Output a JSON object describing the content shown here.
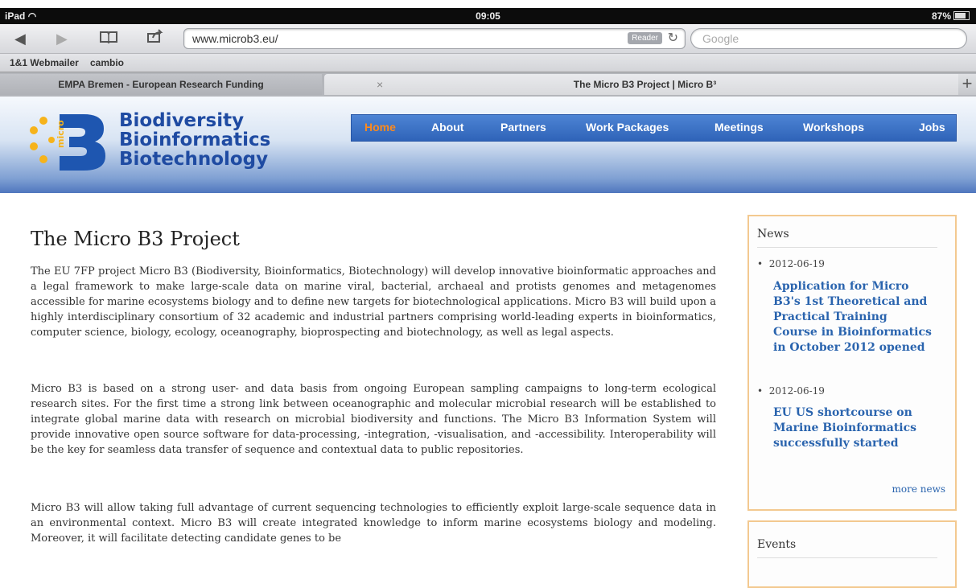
{
  "status": {
    "device": "iPad",
    "time": "09:05",
    "battery": "87%"
  },
  "browser": {
    "url": "www.microb3.eu/",
    "reader_label": "Reader",
    "search_placeholder": "Google",
    "bookmarks": [
      "1&1 Webmailer",
      "cambio"
    ],
    "tabs": [
      {
        "title": "EMPA Bremen - European Research Funding"
      },
      {
        "title": "The Micro B3 Project | Micro B³"
      }
    ],
    "close_glyph": "×",
    "new_tab_glyph": "+"
  },
  "site": {
    "logo_lines": [
      "Biodiversity",
      "Bioinformatics",
      "Biotechnology"
    ],
    "logo_mark_text": "micro",
    "nav": [
      "Home",
      "About",
      "Partners",
      "Work Packages",
      "Meetings",
      "Workshops",
      "Jobs"
    ],
    "active_nav": "Home"
  },
  "main": {
    "title": "The Micro B3 Project",
    "paragraphs": [
      "The EU 7FP project Micro B3 (Biodiversity, Bioinformatics, Biotechnology) will develop innovative bioinformatic approaches and a legal framework to make large-scale data on marine viral, bacterial, archaeal and protists genomes and metagenomes accessible for marine ecosystems biology and to define new targets for biotechnological applications. Micro B3 will build upon a highly interdisciplinary consortium of 32 academic and industrial partners comprising world-leading experts in bioinformatics, computer science, biology, ecology, oceanography, bioprospecting and biotechnology, as well as legal aspects.",
      "Micro B3 is based on a strong user- and data basis from ongoing European sampling campaigns to long-term ecological research sites. For the first time a strong link between oceanographic and molecular microbial research will be established to integrate global marine data with research on microbial biodiversity and functions. The Micro B3 Information System will provide innovative open source software for data-processing, -integration, -visualisation, and -accessibility. Interoperability will be the key for seamless data transfer of sequence and contextual data to public repositories.",
      "Micro B3 will allow taking full advantage of current sequencing technologies to efficiently exploit large-scale sequence data in an environmental context. Micro B3 will create integrated knowledge to inform marine ecosystems biology and modeling. Moreover, it will facilitate detecting candidate genes to be"
    ]
  },
  "sidebar": {
    "news_title": "News",
    "news": [
      {
        "date": "2012-06-19",
        "title": "Application for Micro B3's 1st Theoretical and Practical Training Course in Bioinformatics in October 2012 opened"
      },
      {
        "date": "2012-06-19",
        "title": "EU US shortcourse on Marine Bioinformatics successfully started"
      }
    ],
    "more_news": "more news",
    "events_title": "Events"
  },
  "colors": {
    "nav_active": "#ff8a1c",
    "link": "#2a64ae",
    "logo": "#1f4ba2",
    "box_border": "#f3c990"
  }
}
